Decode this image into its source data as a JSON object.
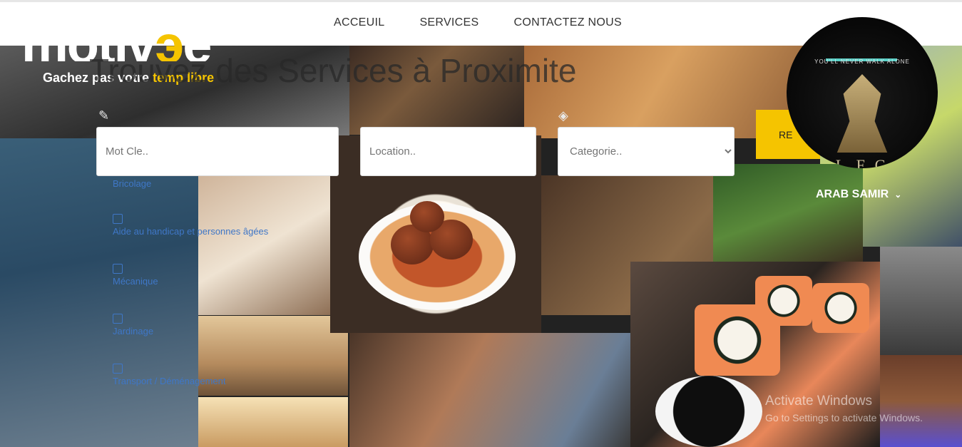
{
  "nav": {
    "items": [
      "ACCEUIL",
      "SERVICES",
      "CONTACTEZ NOUS"
    ]
  },
  "brand": {
    "logo_text": "motive",
    "tagline_prefix": "Gachez pas votre",
    "tagline_highlight": "temp libre"
  },
  "hero": {
    "title": "Trouvez des Services à Proximite"
  },
  "search": {
    "keyword_placeholder": "Mot Cle..",
    "location_placeholder": "Location..",
    "category_selected": "Categorie..",
    "submit_label": "RE"
  },
  "categories": [
    {
      "label": "Bricolage"
    },
    {
      "label": "Aide au handicap et personnes âgées"
    },
    {
      "label": "Mécanique"
    },
    {
      "label": "Jardinage"
    },
    {
      "label": "Transport / Déménagement"
    }
  ],
  "user": {
    "name": "ARAB SAMIR",
    "avatar_top_text": "YOU'LL NEVER WALK ALONE",
    "avatar_bottom_text": "L.F.C"
  },
  "watermark": {
    "line1": "Activate Windows",
    "line2": "Go to Settings to activate Windows."
  },
  "colors": {
    "accent": "#f5c400",
    "link": "#3f77c7"
  }
}
